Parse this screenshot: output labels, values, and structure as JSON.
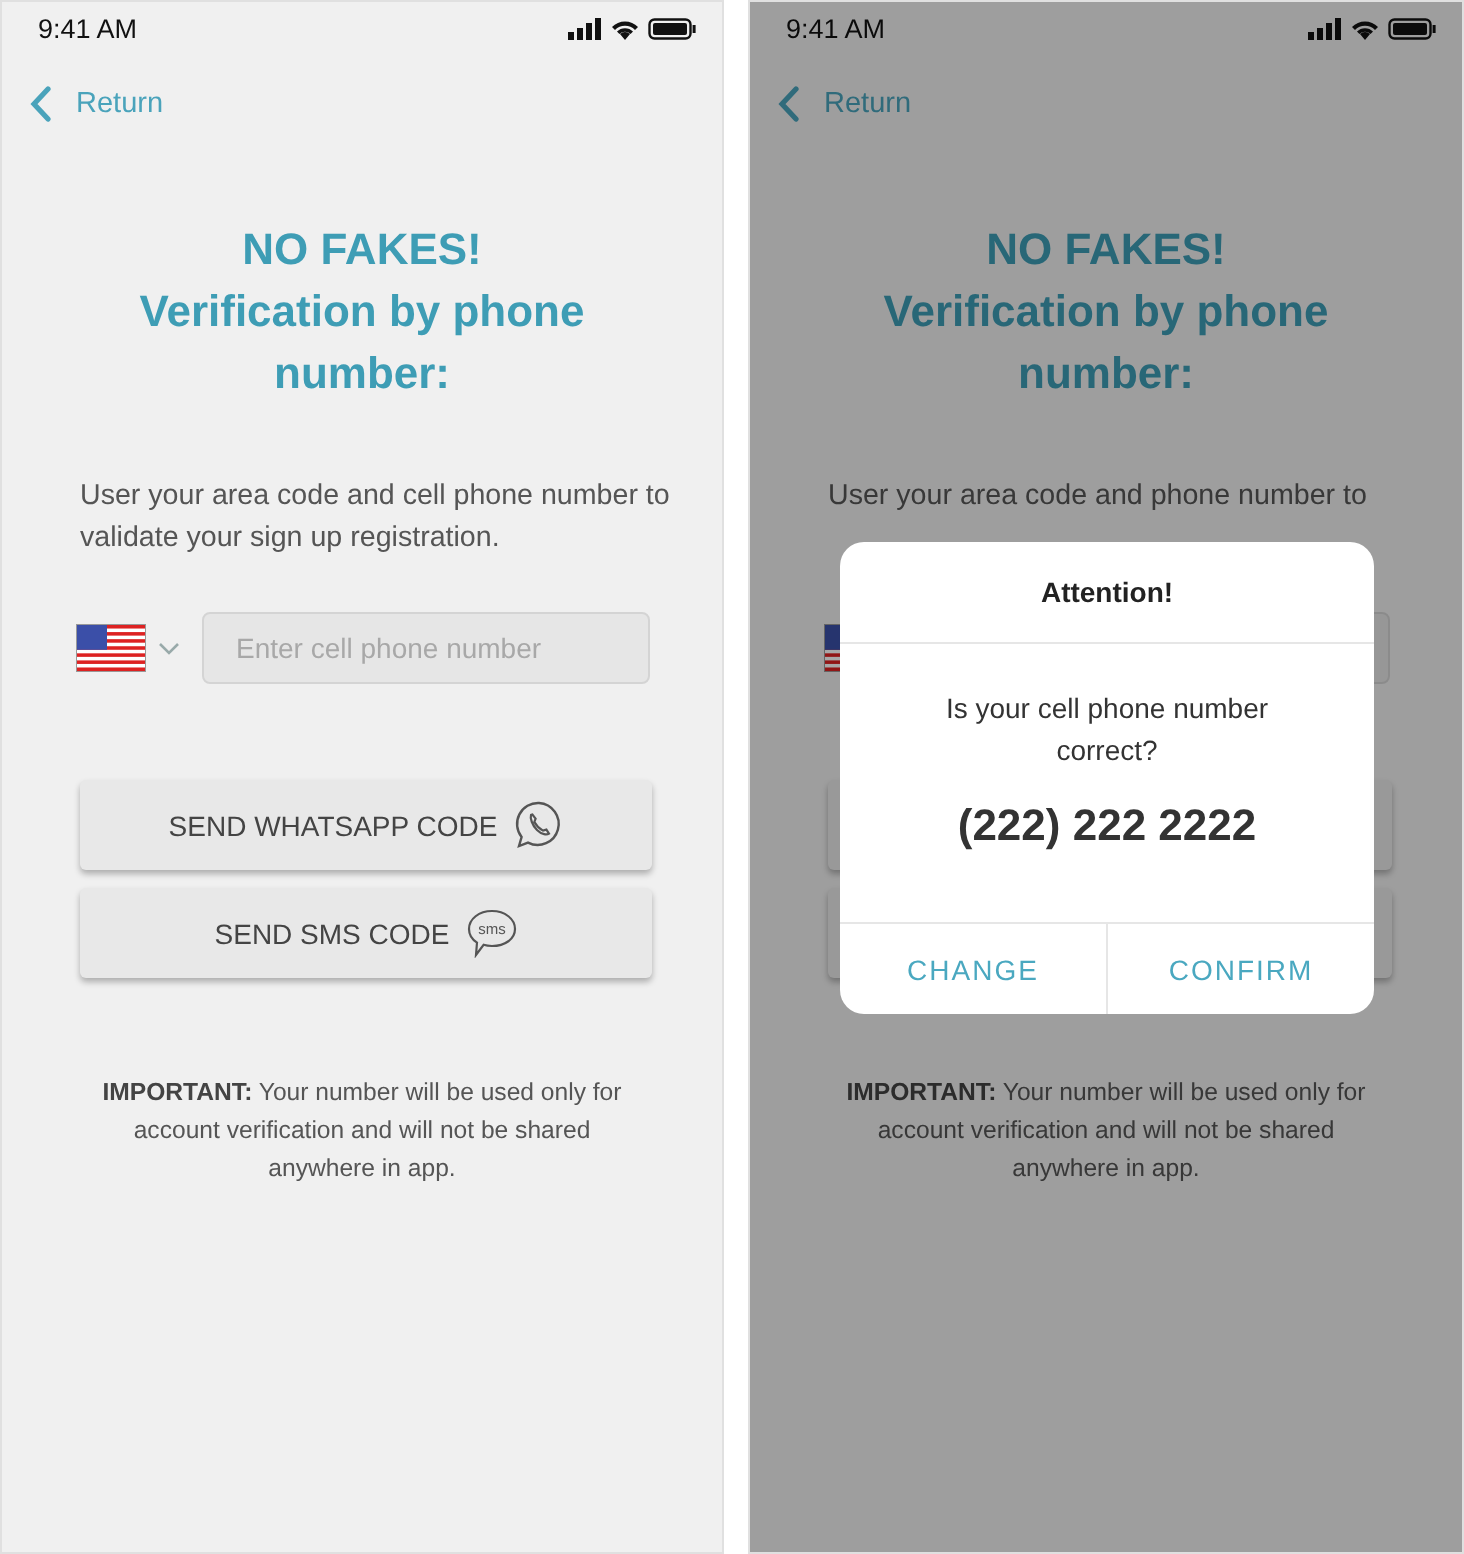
{
  "screens": [
    {
      "status_bar": {
        "time": "9:41 AM"
      },
      "back": {
        "label": "Return"
      },
      "title": [
        "NO FAKES!",
        "Verification by phone number:"
      ],
      "instruction": "User your area code and cell phone number to validate your sign up registration.",
      "phone_field": {
        "placeholder": "Enter cell phone number"
      },
      "buttons": [
        {
          "kind": "whatsapp",
          "label": "SEND WHATSAPP CODE"
        },
        {
          "kind": "sms",
          "label": "SEND SMS CODE",
          "icon_label": "sms"
        }
      ],
      "notice": "**IMPORTANT:** Your number will be used only for account verification and will not be shared anywhere in app."
    },
    {
      "status_bar": {
        "time": "9:41 AM"
      },
      "back": {
        "label": "Return"
      },
      "title": [
        "NO FAKES!",
        "Verification by phone number:"
      ],
      "instruction": "User your area code and phone number to",
      "buttons": [
        {
          "kind": "blank"
        },
        {
          "kind": "blank"
        }
      ],
      "notice": "**IMPORTANT:** Your number will be used only for account verification and will not be shared anywhere in app.",
      "dialog": {
        "title": "Attention!",
        "message": "Is your cell phone number correct?",
        "phone": "(222) 222 2222",
        "actions": [
          "CHANGE",
          "CONFIRM"
        ]
      }
    }
  ]
}
